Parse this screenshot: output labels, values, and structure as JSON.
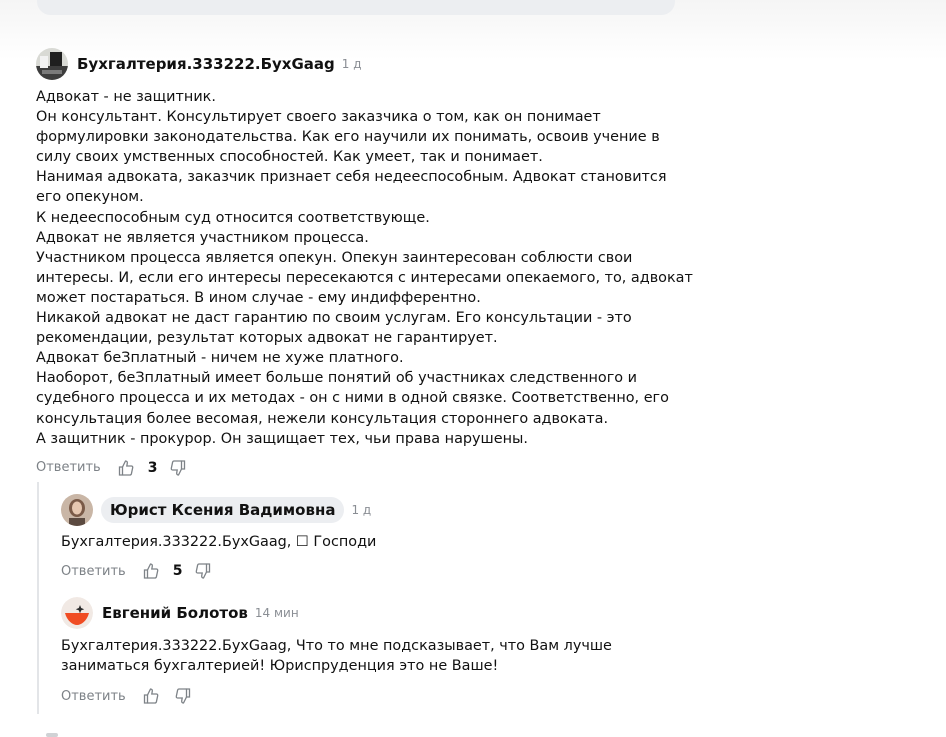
{
  "comments": [
    {
      "author": "Бухгалтерия.333222.БухGaag",
      "time": "1 д",
      "lines": [
        "Адвокат - не защитник.",
        "Он консультант. Консультирует своего заказчика о том, как он понимает",
        "формулировки законодательства. Как его научили их понимать, освоив учение в",
        "силу своих умственных способностей. Как умеет, так и понимает.",
        "Нанимая адвоката, заказчик признает себя недееспособным. Адвокат становится",
        "его опекуном.",
        "К недееспособным суд относится соответствующе.",
        "Адвокат не является участником процесса.",
        "Участником процесса является опекун. Опекун заинтересован соблюсти свои",
        "интересы. И, если его интересы пересекаются с интересами опекаемого, то, адвокат",
        "может постараться. В ином случае - ему индифферентно.",
        "Никакой адвокат не даст гарантию по своим услугам. Его консультации - это",
        "рекомендации, результат которых адвокат не гарантирует.",
        "Адвокат беЗплатный - ничем не хуже платного.",
        "Наоборот, беЗплатный имеет больше понятий об участниках следственного и",
        "судебного процесса и их методах - он с ними в одной связке. Соответственно, его",
        "консультация более весомая, нежели консультация стороннего адвоката.",
        "А защитник - прокурор. Он защищает тех, чьи права нарушены."
      ],
      "reply_label": "Ответить",
      "likes": "3"
    },
    {
      "author": "Юрист Ксения Вадимовна",
      "time": "1 д",
      "lines": [
        "Бухгалтерия.333222.БухGaag, ☐ Господи"
      ],
      "reply_label": "Ответить",
      "likes": "5"
    },
    {
      "author": "Евгений Болотов",
      "time": "14 мин",
      "lines": [
        "Бухгалтерия.333222.БухGaag, Что то мне подсказывает, что Вам лучше",
        "заниматься бухгалтерией! Юриспруденция это не Ваше!"
      ],
      "reply_label": "Ответить",
      "likes": ""
    }
  ],
  "icons": {
    "like": "thumbs-up-icon",
    "dislike": "thumbs-down-icon"
  },
  "colors": {
    "muted": "#7d8287",
    "chip_bg": "#eceef1",
    "accent": "#f04c23"
  }
}
